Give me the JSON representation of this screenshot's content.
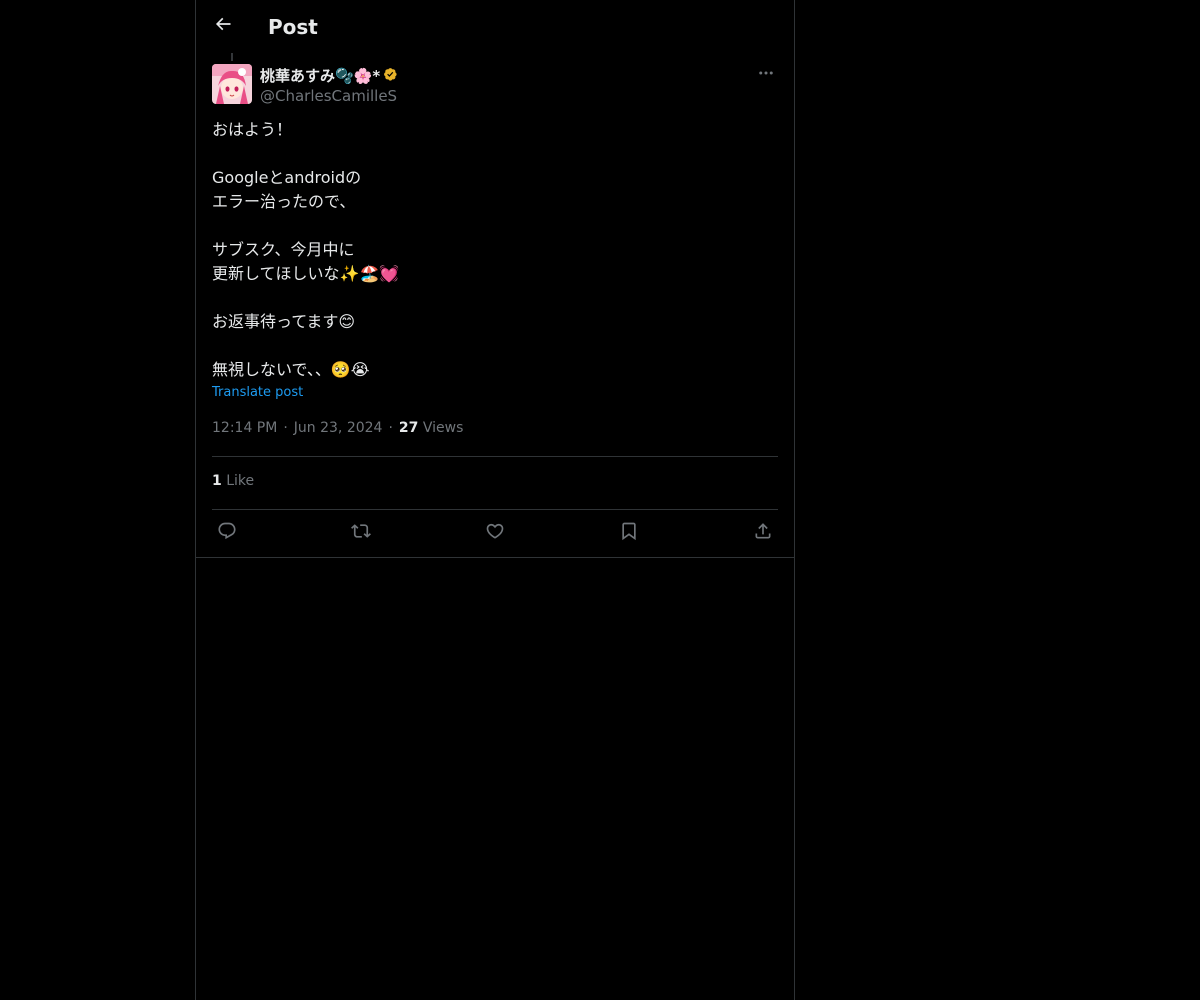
{
  "header": {
    "back_icon": "arrow-left-icon",
    "title": "Post"
  },
  "post": {
    "author": {
      "display_name": "桃華あすみ🫧🌸*",
      "handle": "@CharlesCamilleS",
      "verified_icon": "verified-badge-icon",
      "verified_color": "#e8b32a"
    },
    "more_icon": "more-horizontal-icon",
    "text_lines": [
      "おはよう！",
      "",
      "Googleとandroidの",
      "エラー治ったので、",
      "",
      "サブスク、今月中に",
      "更新してほしいな✨🏖️💓",
      "",
      "お返事待ってます😊",
      "",
      "無視しないで、、🥺😭"
    ],
    "translate_label": "Translate post",
    "time": "12:14 PM",
    "separator": "·",
    "date": "Jun 23, 2024",
    "views_count": "27",
    "views_label": "Views",
    "likes_count": "1",
    "likes_label": "Like"
  },
  "actions": [
    {
      "icon": "reply-icon"
    },
    {
      "icon": "repost-icon"
    },
    {
      "icon": "like-icon"
    },
    {
      "icon": "bookmark-icon"
    },
    {
      "icon": "share-icon"
    }
  ],
  "colors": {
    "background": "#000000",
    "text": "#e7e9ea",
    "secondary_text": "#71767b",
    "link": "#1d9bf0",
    "border": "#2f3336"
  }
}
